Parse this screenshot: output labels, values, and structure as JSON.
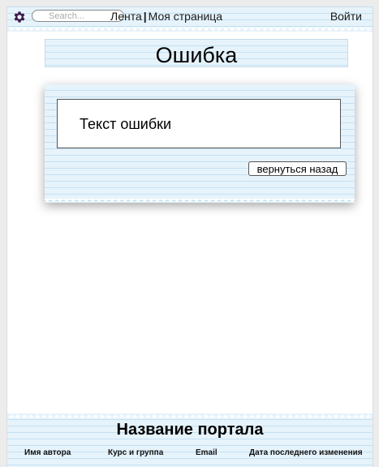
{
  "header": {
    "search_placeholder": "Search...",
    "nav_feed": "Лента",
    "nav_separator": "|",
    "nav_my_page": "Моя страница",
    "login": "Войти",
    "gear_color": "#3d1a4a"
  },
  "main": {
    "title": "Ошибка",
    "error_text": "Текст ошибки",
    "back_button": "вернуться назад"
  },
  "footer": {
    "portal_name": "Название портала",
    "author_name": "Имя автора",
    "course_group": "Курс и группа",
    "email": "Email",
    "last_modified": "Дата последнего изменения"
  },
  "colors": {
    "paper": "#e6f3fb",
    "paper_lines": "#c4e0f2",
    "background": "#ececec"
  }
}
